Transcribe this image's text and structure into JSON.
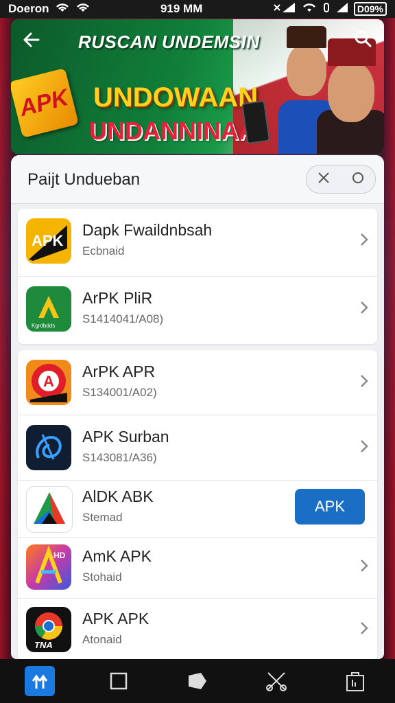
{
  "status_bar": {
    "carrier": "Doeron",
    "time": "919 MM",
    "battery": "D09%"
  },
  "banner": {
    "title": "RUSCAN UNDEMSIN",
    "line1": "UNDOWAAN",
    "line2": "UNDANNINAA",
    "badge": "APK"
  },
  "sheet": {
    "title": "Paijt Undueban"
  },
  "apps_group1": [
    {
      "name": "Dapk Fwaildnbsah",
      "sub": "Ecbnaid",
      "icon_text": "APK",
      "icon": "apk-black-icon"
    },
    {
      "name": "ArPK PliR",
      "sub": "S1414041/A08)",
      "icon_text": "Kgrdbdds",
      "icon": "green-a-icon"
    }
  ],
  "apps_group2": [
    {
      "name": "ArPK APR",
      "sub": "S134001/A02)",
      "icon_text": "A",
      "icon": "red-a-icon"
    },
    {
      "name": "APK Surban",
      "sub": "S143081/A36)",
      "icon_text": "",
      "icon": "blue-swirl-icon"
    },
    {
      "name": "AlDK ABK",
      "sub": "Stemad",
      "icon_text": "",
      "icon": "tricolor-a-icon",
      "button": "APK"
    },
    {
      "name": "AmK APK",
      "sub": "Stohaid",
      "icon_text": "HD",
      "icon": "gradient-a-icon"
    },
    {
      "name": "APK APK",
      "sub": "Atonaid",
      "icon_text": "TNA",
      "icon": "chrome-like-icon"
    }
  ],
  "colors": {
    "accent_blue": "#1a6fc4",
    "banner_green": "#11803a",
    "banner_yellow": "#ffd21e",
    "banner_red": "#e8213a"
  }
}
